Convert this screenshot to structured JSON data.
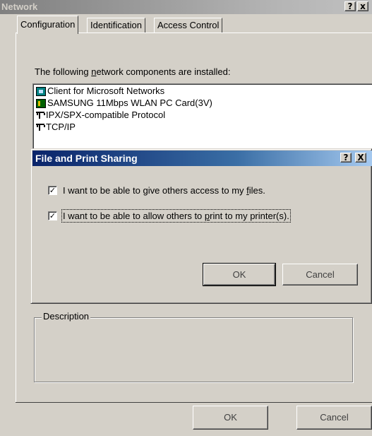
{
  "window": {
    "title": "Network",
    "help_glyph": "?",
    "close_glyph": "x"
  },
  "tabs": [
    {
      "label_pre": "Configuration",
      "label_u": "",
      "label_post": "",
      "active": true
    },
    {
      "label_pre": "Identification",
      "label_u": "",
      "label_post": "",
      "active": false
    },
    {
      "label_pre": "Access Control",
      "label_u": "",
      "label_post": "",
      "active": false
    }
  ],
  "components": {
    "heading_pre": "The following ",
    "heading_u": "n",
    "heading_post": "etwork components are installed:",
    "items": [
      {
        "icon": "network-client-icon",
        "label": "Client for Microsoft Networks"
      },
      {
        "icon": "network-card-icon",
        "label": "SAMSUNG 11Mbps WLAN PC Card(3V)"
      },
      {
        "icon": "protocol-icon",
        "label": "IPX/SPX-compatible Protocol"
      },
      {
        "icon": "protocol-icon",
        "label": "TCP/IP"
      }
    ]
  },
  "description": {
    "label": "Description"
  },
  "buttons": {
    "ok": "OK",
    "cancel": "Cancel"
  },
  "dialog": {
    "title": "File and Print Sharing",
    "help_glyph": "?",
    "close_glyph": "X",
    "options": [
      {
        "pre": "I want to be able to give others access to my ",
        "u": "f",
        "post": "iles.",
        "checked": true
      },
      {
        "pre": "I want to be able to allow others to ",
        "u": "p",
        "post": "rint to my printer(s).",
        "checked": true
      }
    ],
    "check_glyph": "✓",
    "ok": "OK",
    "cancel": "Cancel"
  }
}
